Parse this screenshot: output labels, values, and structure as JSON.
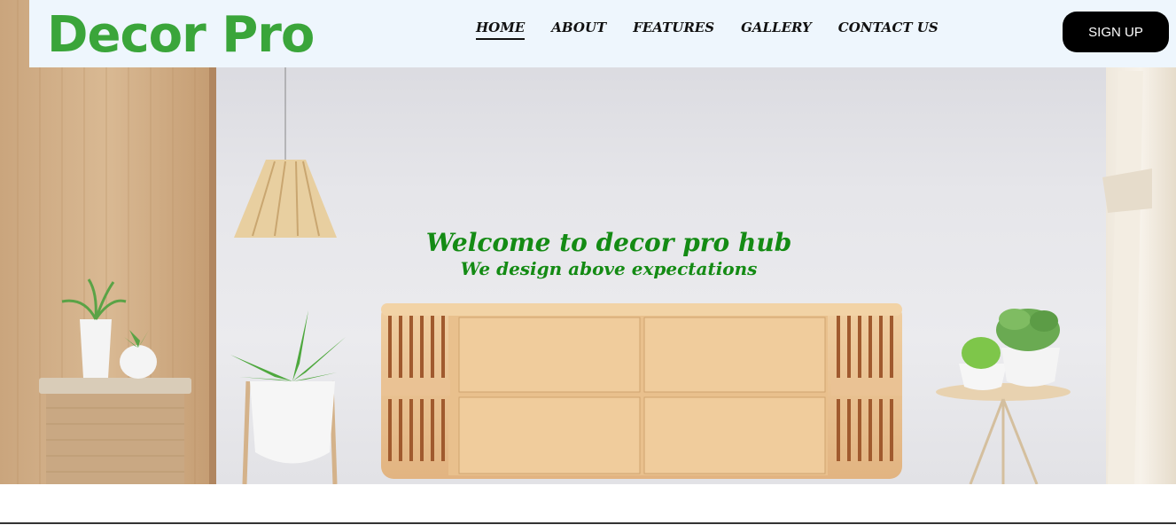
{
  "brand": {
    "logo_text": "Decor Pro"
  },
  "nav": {
    "items": [
      {
        "label": "HOME",
        "active": true
      },
      {
        "label": "ABOUT",
        "active": false
      },
      {
        "label": "FEATURES",
        "active": false
      },
      {
        "label": "GALLERY",
        "active": false
      },
      {
        "label": "CONTACT US",
        "active": false
      }
    ]
  },
  "header": {
    "signup_label": "SIGN UP"
  },
  "hero": {
    "title": "Welcome to decor pro hub",
    "subtitle": "We design above expectations",
    "image_description_icon": "living-room-interior-image"
  },
  "colors": {
    "logo": "#3aa53a",
    "hero_text": "#148b14",
    "header_bg": "#eef6fd",
    "signup_bg": "#000000"
  }
}
